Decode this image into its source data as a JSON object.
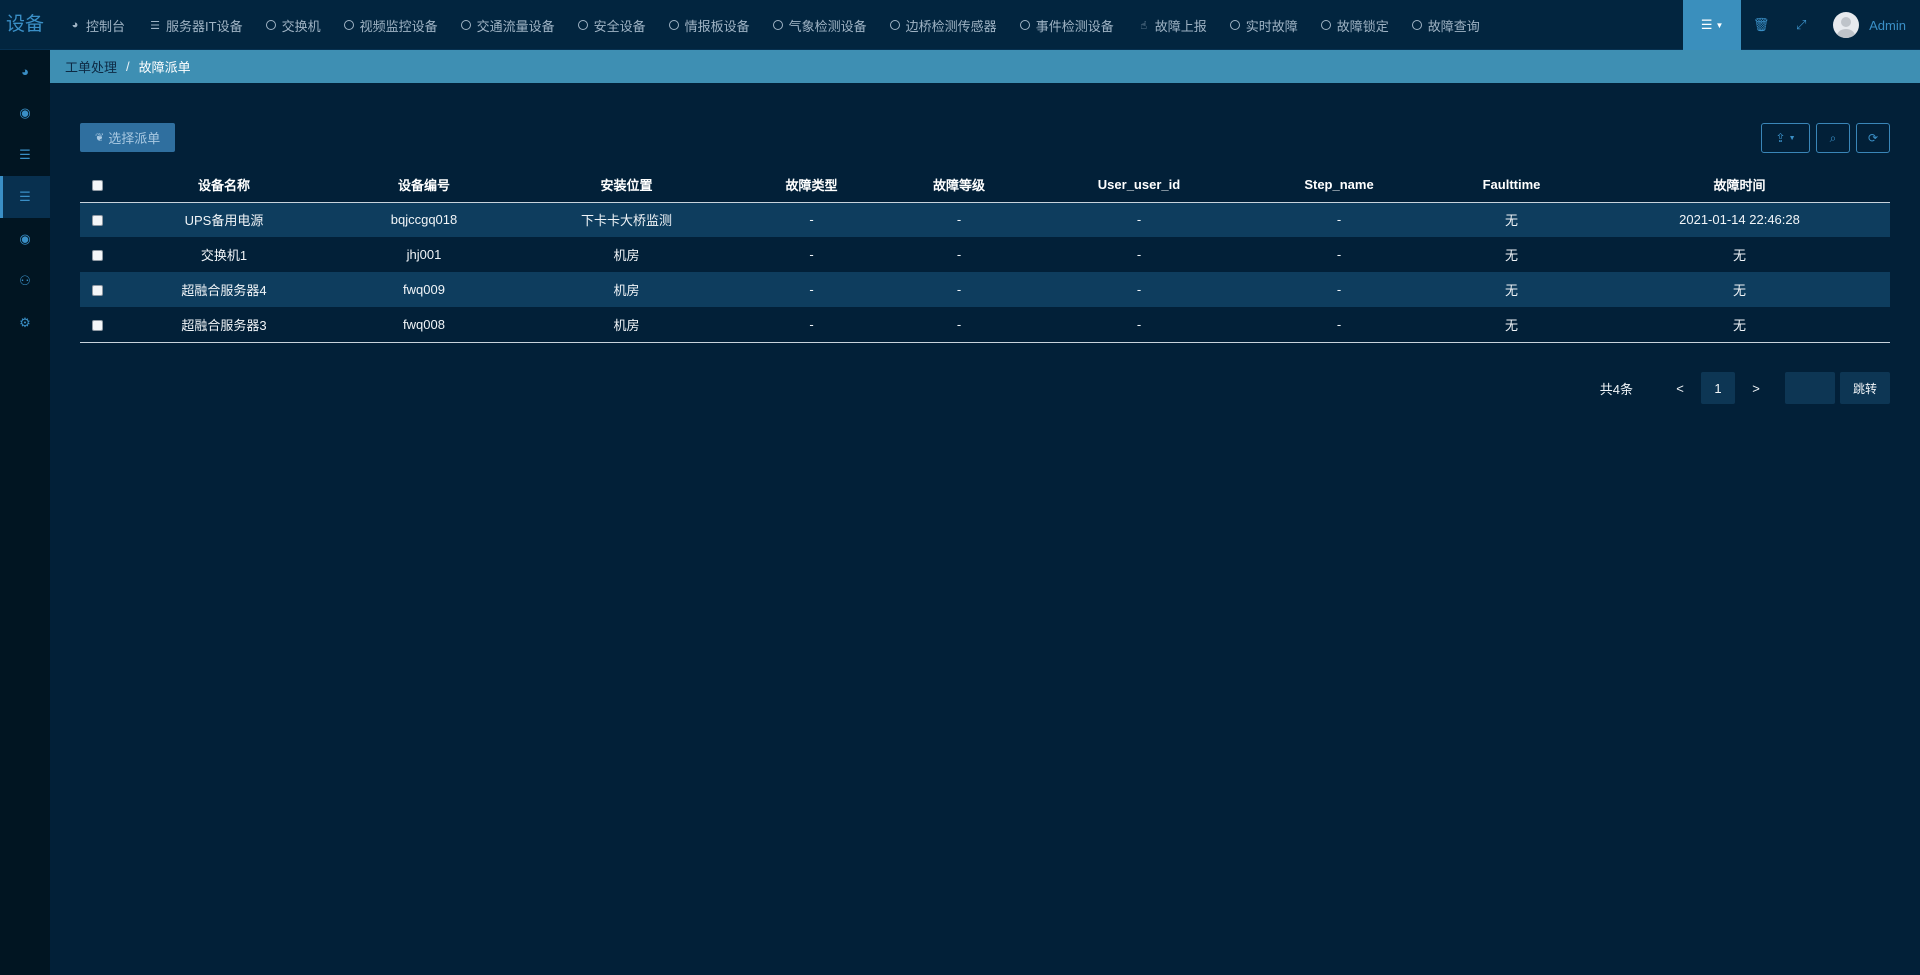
{
  "brand": "设备",
  "nav": [
    {
      "label": "控制台",
      "icon": "dashboard-icon"
    },
    {
      "label": "服务器IT设备",
      "icon": "server-icon"
    },
    {
      "label": "交换机",
      "icon": "circle-icon"
    },
    {
      "label": "视频监控设备",
      "icon": "circle-icon"
    },
    {
      "label": "交通流量设备",
      "icon": "circle-icon"
    },
    {
      "label": "安全设备",
      "icon": "circle-icon"
    },
    {
      "label": "情报板设备",
      "icon": "circle-icon"
    },
    {
      "label": "气象检测设备",
      "icon": "circle-icon"
    },
    {
      "label": "边桥检测传感器",
      "icon": "circle-icon"
    },
    {
      "label": "事件检测设备",
      "icon": "circle-icon"
    },
    {
      "label": "故障上报",
      "icon": "hand-pointer-icon"
    },
    {
      "label": "实时故障",
      "icon": "circle-icon"
    },
    {
      "label": "故障锁定",
      "icon": "circle-icon"
    },
    {
      "label": "故障查询",
      "icon": "circle-icon"
    }
  ],
  "user": {
    "name": "Admin"
  },
  "sidebar": [
    {
      "icon": "dashboard-icon",
      "glyph": "◕",
      "active": false
    },
    {
      "icon": "eye-icon",
      "glyph": "◉",
      "active": false
    },
    {
      "icon": "list-icon",
      "glyph": "☰",
      "active": false
    },
    {
      "icon": "list-icon",
      "glyph": "☰",
      "active": true
    },
    {
      "icon": "eye-icon",
      "glyph": "◉",
      "active": false
    },
    {
      "icon": "users-icon",
      "glyph": "⚇",
      "active": false
    },
    {
      "icon": "cogs-icon",
      "glyph": "⚙",
      "active": false
    }
  ],
  "breadcrumb": {
    "parent": "工单处理",
    "separator": "/",
    "current": "故障派单"
  },
  "toolbar": {
    "dispatch_label": "选择派单"
  },
  "table": {
    "columns": [
      "设备名称",
      "设备编号",
      "安装位置",
      "故障类型",
      "故障等级",
      "User_user_id",
      "Step_name",
      "Faulttime",
      "故障时间"
    ],
    "rows": [
      [
        "UPS备用电源",
        "bqjccgq018",
        "下卡卡大桥监测",
        "-",
        "-",
        "-",
        "-",
        "无",
        "2021-01-14 22:46:28"
      ],
      [
        "交换机1",
        "jhj001",
        "机房",
        "-",
        "-",
        "-",
        "-",
        "无",
        "无"
      ],
      [
        "超融合服务器4",
        "fwq009",
        "机房",
        "-",
        "-",
        "-",
        "-",
        "无",
        "无"
      ],
      [
        "超融合服务器3",
        "fwq008",
        "机房",
        "-",
        "-",
        "-",
        "-",
        "无",
        "无"
      ]
    ]
  },
  "pagination": {
    "total": "共4条",
    "prev": "<",
    "page": "1",
    "next": ">",
    "go": "跳转"
  },
  "colors": {
    "background": "#022038",
    "accent": "#3a8fc6",
    "breadcrumb_bar": "#3e8fb3",
    "row_highlight": "#0e3d5e"
  }
}
